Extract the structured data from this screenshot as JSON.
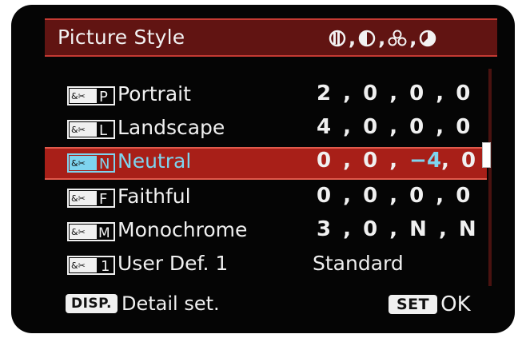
{
  "header": {
    "title": "Picture Style",
    "params": [
      {
        "icon": "sharpness-icon"
      },
      {
        "icon": "contrast-icon"
      },
      {
        "icon": "saturation-icon"
      },
      {
        "icon": "color-tone-icon"
      }
    ]
  },
  "styles": [
    {
      "code": "P",
      "name": "Portrait",
      "values": "2 , 0 , 0 , 0",
      "selected": false
    },
    {
      "code": "L",
      "name": "Landscape",
      "values": "4 , 0 , 0 , 0",
      "selected": false
    },
    {
      "code": "N",
      "name": "Neutral",
      "values_prefix": "0 , 0 , ",
      "values_highlight": "−4",
      "values_suffix": ", 0",
      "selected": true
    },
    {
      "code": "F",
      "name": "Faithful",
      "values": "0 , 0 , 0 , 0",
      "selected": false
    },
    {
      "code": "M",
      "name": "Monochrome",
      "values": "3 , 0 , N , N",
      "selected": false
    },
    {
      "code": "1",
      "name": "User Def. 1",
      "values": "Standard",
      "selected": false
    }
  ],
  "footer": {
    "disp_key": "DISP.",
    "disp_label": "Detail set.",
    "set_key": "SET",
    "set_label": "OK"
  },
  "colors": {
    "header_bg": "#611412",
    "selection_bg": "#a81f18",
    "highlight_text": "#7ed4ef",
    "text": "#f0f0f0",
    "screen_bg": "#050505"
  }
}
